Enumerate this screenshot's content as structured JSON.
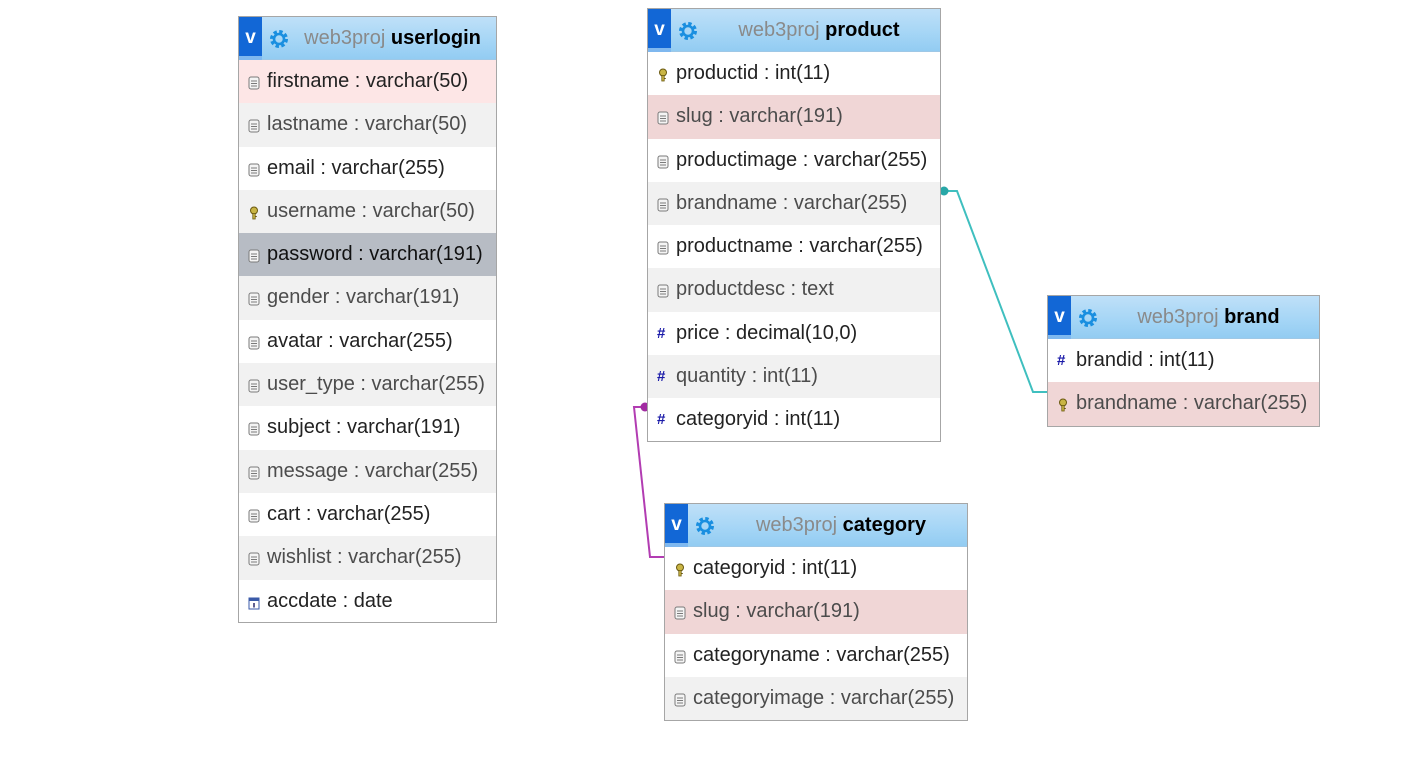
{
  "tables": {
    "userlogin": {
      "db": "web3proj",
      "name": "userlogin",
      "columns": [
        {
          "text": "firstname : varchar(50)",
          "icon": "field-icon"
        },
        {
          "text": "lastname : varchar(50)",
          "icon": "field-icon"
        },
        {
          "text": "email : varchar(255)",
          "icon": "field-icon"
        },
        {
          "text": "username : varchar(50)",
          "icon": "key-icon"
        },
        {
          "text": "password : varchar(191)",
          "icon": "field-icon"
        },
        {
          "text": "gender : varchar(191)",
          "icon": "field-icon"
        },
        {
          "text": "avatar : varchar(255)",
          "icon": "field-icon"
        },
        {
          "text": "user_type : varchar(255)",
          "icon": "field-icon"
        },
        {
          "text": "subject : varchar(191)",
          "icon": "field-icon"
        },
        {
          "text": "message : varchar(255)",
          "icon": "field-icon"
        },
        {
          "text": "cart : varchar(255)",
          "icon": "field-icon"
        },
        {
          "text": "wishlist : varchar(255)",
          "icon": "field-icon"
        },
        {
          "text": "accdate : date",
          "icon": "date-icon"
        }
      ]
    },
    "product": {
      "db": "web3proj",
      "name": "product",
      "columns": [
        {
          "text": "productid : int(11)",
          "icon": "key-icon"
        },
        {
          "text": "slug : varchar(191)",
          "icon": "field-icon"
        },
        {
          "text": "productimage : varchar(255)",
          "icon": "field-icon"
        },
        {
          "text": "brandname : varchar(255)",
          "icon": "field-icon"
        },
        {
          "text": "productname : varchar(255)",
          "icon": "field-icon"
        },
        {
          "text": "productdesc : text",
          "icon": "field-icon"
        },
        {
          "text": "price : decimal(10,0)",
          "icon": "number-icon"
        },
        {
          "text": "quantity : int(11)",
          "icon": "number-icon"
        },
        {
          "text": "categoryid : int(11)",
          "icon": "number-icon"
        }
      ]
    },
    "category": {
      "db": "web3proj",
      "name": "category",
      "columns": [
        {
          "text": "categoryid : int(11)",
          "icon": "key-icon"
        },
        {
          "text": "slug : varchar(191)",
          "icon": "field-icon"
        },
        {
          "text": "categoryname : varchar(255)",
          "icon": "field-icon"
        },
        {
          "text": "categoryimage : varchar(255)",
          "icon": "field-icon"
        }
      ]
    },
    "brand": {
      "db": "web3proj",
      "name": "brand",
      "columns": [
        {
          "text": "brandid : int(11)",
          "icon": "number-icon"
        },
        {
          "text": "brandname : varchar(255)",
          "icon": "key-icon"
        }
      ]
    }
  },
  "toggle_label": "v",
  "relations": [
    {
      "from": "product.brandname",
      "to": "brand.brandname",
      "color": "#3fbfbf"
    },
    {
      "from": "product.categoryid",
      "to": "category.categoryid",
      "color": "#b23cb2"
    }
  ],
  "colors": {
    "header_accent": "#1267d6",
    "header_bg": "#a6d6f6",
    "row_alt": "#f1f1f1",
    "row_pink": "#fde6e6",
    "row_rose": "#f0d6d6",
    "row_selected": "#b7bcc4"
  }
}
